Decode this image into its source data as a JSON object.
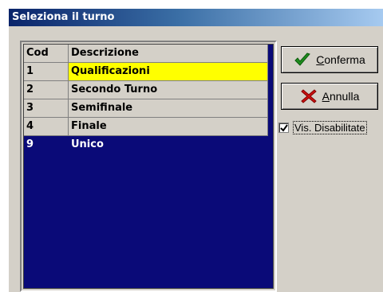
{
  "window": {
    "title": "Seleziona il turno"
  },
  "grid": {
    "columns": [
      "Cod",
      "Descrizione"
    ],
    "rows": [
      {
        "cod": "1",
        "descrizione": "Qualificazioni",
        "highlight": "#ffff00"
      },
      {
        "cod": "2",
        "descrizione": "Secondo Turno"
      },
      {
        "cod": "3",
        "descrizione": "Semifinale"
      },
      {
        "cod": "4",
        "descrizione": "Finale"
      },
      {
        "cod": "9",
        "descrizione": "Unico",
        "selected": true
      }
    ],
    "selected_color": "#0a0a78"
  },
  "buttons": {
    "confirm": {
      "label_underlined": "C",
      "label_rest": "onferma",
      "icon": "check-icon"
    },
    "cancel": {
      "label_underlined": "A",
      "label_rest": "nnulla",
      "icon": "x-icon"
    }
  },
  "options": {
    "show_disabled": {
      "label": "Vis. Disabilitate",
      "checked": true
    }
  }
}
